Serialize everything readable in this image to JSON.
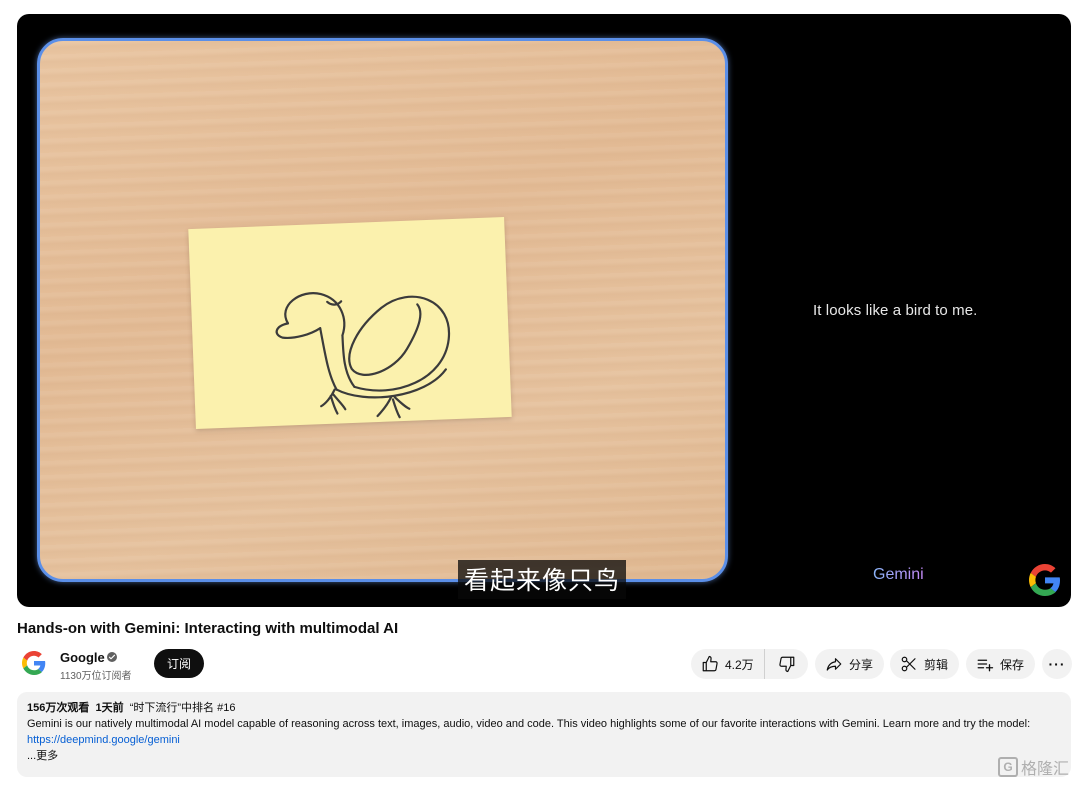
{
  "player": {
    "right_caption": "It looks like a bird to me.",
    "brand_label": "Gemini",
    "subtitle": "看起来像只鸟"
  },
  "video": {
    "title": "Hands-on with Gemini: Interacting with multimodal AI"
  },
  "channel": {
    "name": "Google",
    "subscribers": "1130万位订阅者",
    "subscribe_label": "订阅"
  },
  "actions": {
    "like_count": "4.2万",
    "share_label": "分享",
    "clip_label": "剪辑",
    "save_label": "保存",
    "more_label": "···"
  },
  "description": {
    "views": "156万次观看",
    "age": "1天前",
    "ranking": "“时下流行”中排名 #16",
    "text": "Gemini is our natively multimodal AI model capable of reasoning across text, images, audio, video and code. This video highlights some of our favorite interactions with Gemini. Learn more and try the model: ",
    "link": "https://deepmind.google/gemini",
    "more": "...更多"
  },
  "watermark": {
    "text": "格隆汇"
  },
  "icons": {
    "verified": "verified-check-icon",
    "like": "thumbs-up-icon",
    "dislike": "thumbs-down-icon",
    "share": "share-arrow-icon",
    "clip": "scissors-icon",
    "save": "playlist-add-icon"
  },
  "colors": {
    "scene_border": "#5b8fe8",
    "sticky_note": "#fbf1ad",
    "link": "#065fd4",
    "subscribe_bg": "#0f0f0f"
  }
}
